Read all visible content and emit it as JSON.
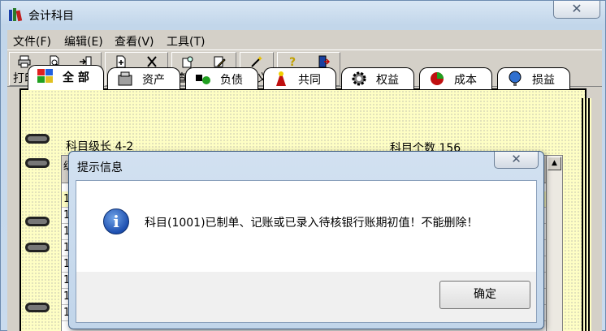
{
  "window": {
    "title": "会计科目",
    "close_glyph": "✕"
  },
  "menu": [
    "文件(F)",
    "编辑(E)",
    "查看(V)",
    "工具(T)"
  ],
  "toolbar": {
    "print": "打印",
    "preview": "预览",
    "export": "输出",
    "add": "增加",
    "delete": "删除",
    "find": "查找",
    "modify": "修改",
    "define": "定义",
    "help": "帮助",
    "exit": "退出"
  },
  "tabs": [
    "全 部",
    "资产",
    "负债",
    "共同",
    "权益",
    "成本",
    "损益"
  ],
  "info": {
    "level_label": "科目级长  4-2",
    "count_label": "科目个数  156"
  },
  "grid": {
    "row_prefix": [
      "1",
      "1",
      "1",
      "1",
      "1",
      "1",
      "1",
      "1",
      "1"
    ],
    "header_first": "级"
  },
  "dialog": {
    "title": "提示信息",
    "close_glyph": "✕",
    "message": "科目(1001)已制单、记账或已录入待核银行账期初值！不能删除！",
    "ok": "确定"
  },
  "colors": {
    "page": "#fefec4",
    "dialog_frame": "#c1d5ea",
    "toolbar": "#d4d0c8"
  }
}
